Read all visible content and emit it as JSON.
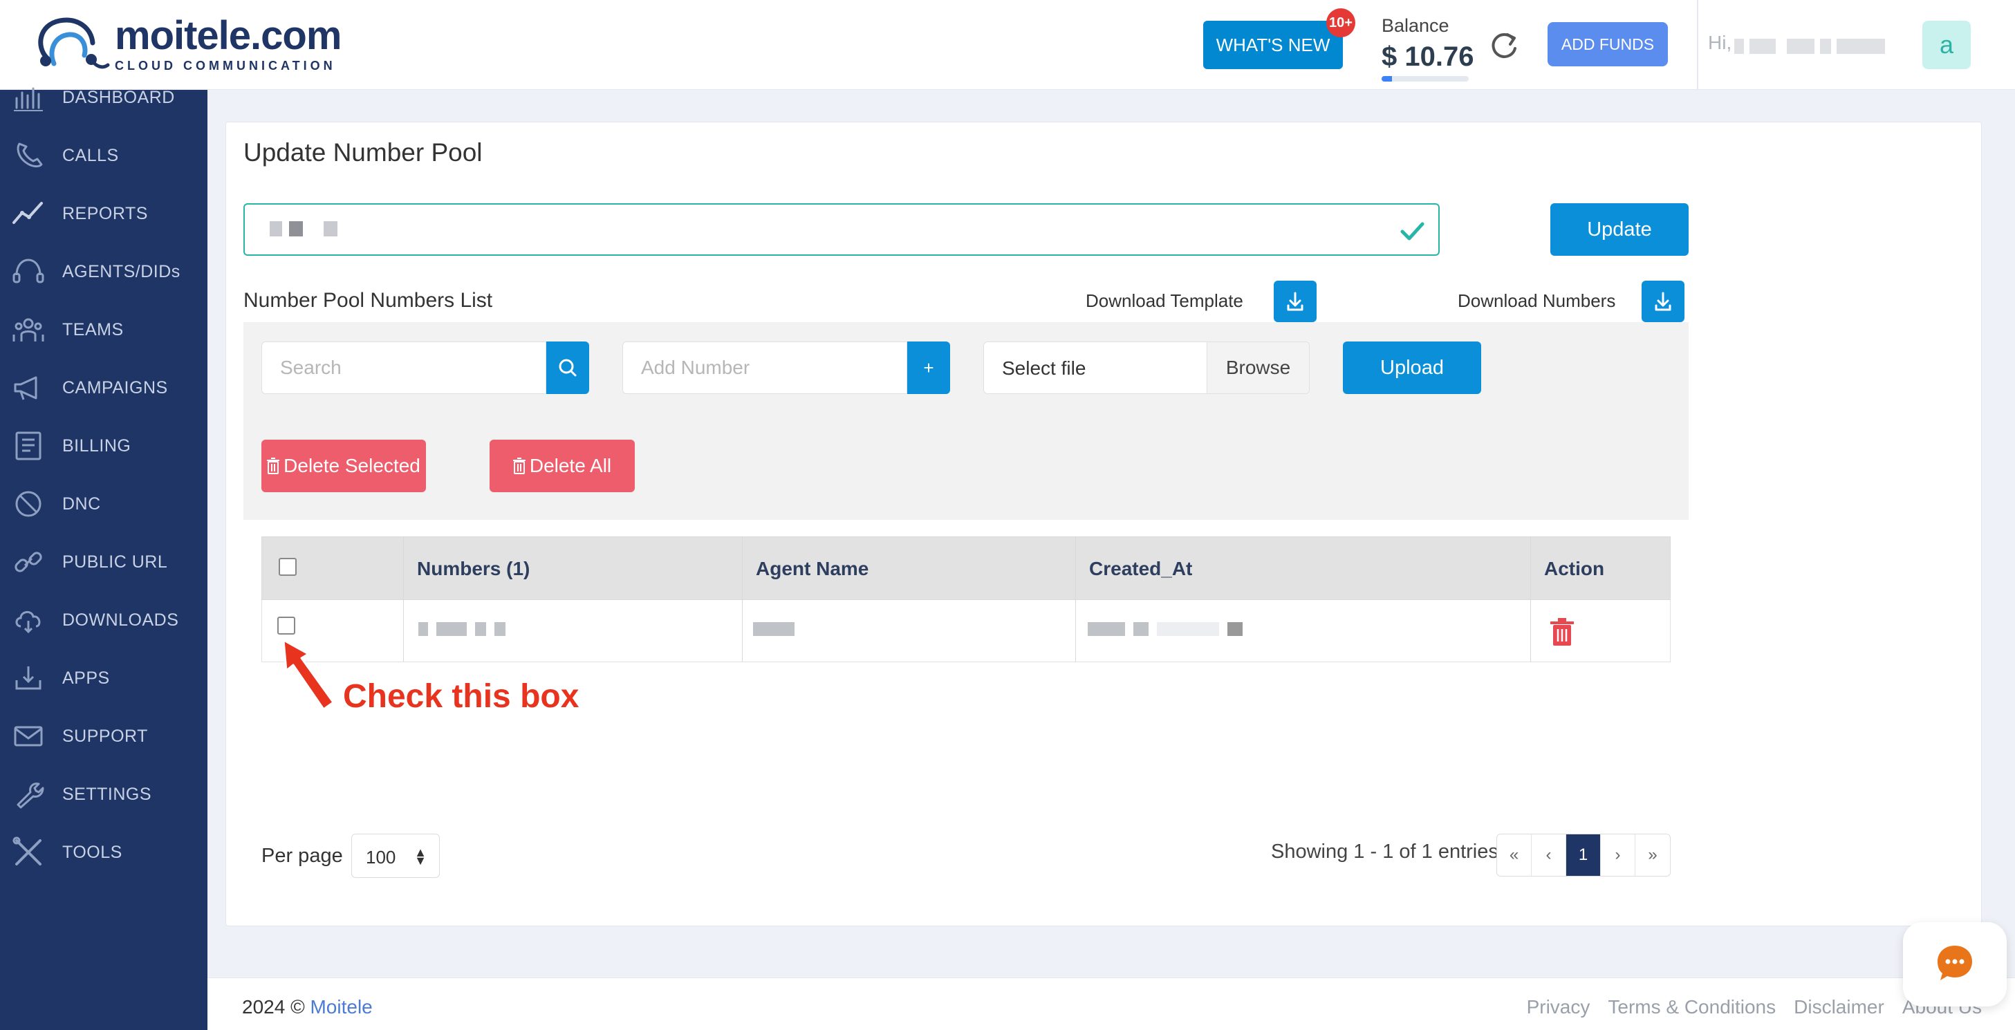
{
  "brand": {
    "name": "moitele.com",
    "tagline": "CLOUD COMMUNICATION"
  },
  "header": {
    "whats_new": "WHAT'S NEW",
    "badge": "10+",
    "balance_label": "Balance",
    "balance_amount": "$ 10.76",
    "balance_progress": 0.12,
    "add_funds": "ADD FUNDS",
    "greeting": "Hi,",
    "avatar_letter": "a"
  },
  "sidebar": {
    "items": [
      {
        "label": "DASHBOARD",
        "icon": "chart-bars-icon"
      },
      {
        "label": "CALLS",
        "icon": "phone-icon"
      },
      {
        "label": "REPORTS",
        "icon": "trend-line-icon"
      },
      {
        "label": "AGENTS/DIDs",
        "icon": "headset-icon"
      },
      {
        "label": "TEAMS",
        "icon": "users-icon"
      },
      {
        "label": "CAMPAIGNS",
        "icon": "megaphone-icon"
      },
      {
        "label": "BILLING",
        "icon": "invoice-icon"
      },
      {
        "label": "DNC",
        "icon": "block-icon"
      },
      {
        "label": "PUBLIC URL",
        "icon": "link-icon"
      },
      {
        "label": "DOWNLOADS",
        "icon": "cloud-download-icon"
      },
      {
        "label": "APPS",
        "icon": "download-tray-icon"
      },
      {
        "label": "SUPPORT",
        "icon": "mail-icon"
      },
      {
        "label": "SETTINGS",
        "icon": "wrench-icon"
      },
      {
        "label": "TOOLS",
        "icon": "tools-icon"
      }
    ]
  },
  "main": {
    "title": "Update Number Pool",
    "update_button": "Update",
    "list_title": "Number Pool Numbers List",
    "download_template": "Download Template",
    "download_numbers": "Download Numbers",
    "search_placeholder": "Search",
    "add_number_placeholder": "Add Number",
    "add_number_button": "+",
    "select_file": "Select file",
    "browse": "Browse",
    "upload": "Upload",
    "delete_selected": "Delete Selected",
    "delete_all": "Delete All"
  },
  "table": {
    "headers": [
      "Numbers (1)",
      "Agent Name",
      "Created_At",
      "Action"
    ]
  },
  "annotation": {
    "text": "Check this box"
  },
  "pagination": {
    "per_page_label": "Per page",
    "per_page_value": "100",
    "showing": "Showing 1 - 1 of 1 entries",
    "first": "«",
    "prev": "‹",
    "current": "1",
    "next": "›",
    "last": "»"
  },
  "footer": {
    "copyright": "2024 ©",
    "brand_link": "Moitele",
    "links": [
      "Privacy",
      "Terms & Conditions",
      "Disclaimer",
      "About Us"
    ]
  },
  "colors": {
    "sidebar_bg": "#1f3566",
    "primary": "#0b8fd8",
    "danger": "#ee5d6c",
    "annotation": "#e8341f",
    "accent_teal": "#26b5a7"
  }
}
